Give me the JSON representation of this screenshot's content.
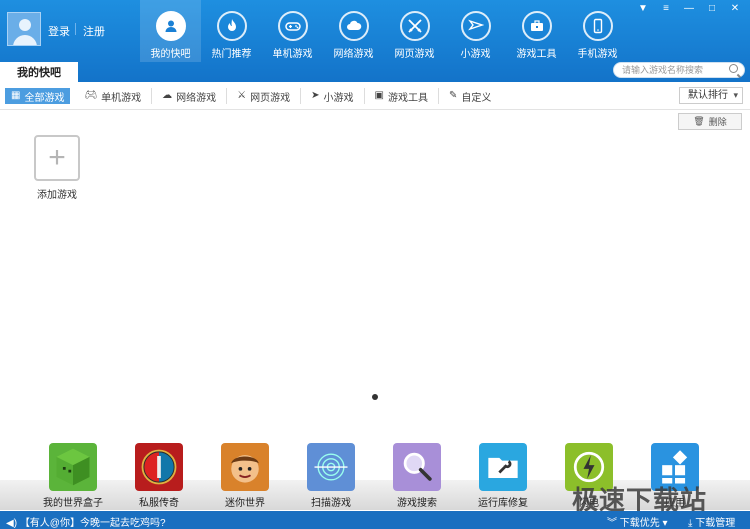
{
  "header": {
    "login_label": "登录",
    "register_label": "注册",
    "nav": [
      {
        "label": "我的快吧",
        "icon": "user-icon",
        "active": true
      },
      {
        "label": "热门推荐",
        "icon": "flame-icon"
      },
      {
        "label": "单机游戏",
        "icon": "gamepad-icon"
      },
      {
        "label": "网络游戏",
        "icon": "cloud-icon"
      },
      {
        "label": "网页游戏",
        "icon": "swords-icon"
      },
      {
        "label": "小游戏",
        "icon": "paper-plane-icon"
      },
      {
        "label": "游戏工具",
        "icon": "toolbox-icon"
      },
      {
        "label": "手机游戏",
        "icon": "phone-icon"
      }
    ],
    "window_buttons": [
      "skin-icon",
      "menu-icon",
      "minimize-icon",
      "maximize-icon",
      "close-icon"
    ],
    "tab_label": "我的快吧",
    "search_placeholder": "请输入游戏名称搜索"
  },
  "filters": [
    {
      "label": "全部游戏",
      "icon": "grid-icon",
      "active": true
    },
    {
      "label": "单机游戏",
      "icon": "gamepad-icon"
    },
    {
      "label": "网络游戏",
      "icon": "cloud-icon"
    },
    {
      "label": "网页游戏",
      "icon": "swords-icon"
    },
    {
      "label": "小游戏",
      "icon": "paper-plane-icon"
    },
    {
      "label": "游戏工具",
      "icon": "toolbox-icon"
    },
    {
      "label": "自定义",
      "icon": "pencil-icon"
    }
  ],
  "sort_label": "默认排行",
  "delete_label": "删除",
  "add_game_label": "添加游戏",
  "dock": [
    {
      "label": "我的世界盒子",
      "color": "#5bb43a"
    },
    {
      "label": "私服传奇",
      "color": "#b81d1d"
    },
    {
      "label": "迷你世界",
      "color": "#d9822b"
    },
    {
      "label": "扫描游戏",
      "color": "#5f8fd6"
    },
    {
      "label": "游戏搜索",
      "color": "#a88fd8"
    },
    {
      "label": "运行库修复",
      "color": "#2aa7e0"
    },
    {
      "label": "闪电",
      "color": "#8cbf2a"
    },
    {
      "label": "应用",
      "color": "#2a93e0"
    }
  ],
  "status": {
    "message": "【有人@你】今晚一起去吃鸡吗?",
    "download_priority": "下载优先",
    "download_manager": "下载管理"
  },
  "watermark": "极速下载站",
  "colors": {
    "header": "#1a80d5",
    "status": "#1a6fc0",
    "active_filter": "#4c9de0"
  }
}
